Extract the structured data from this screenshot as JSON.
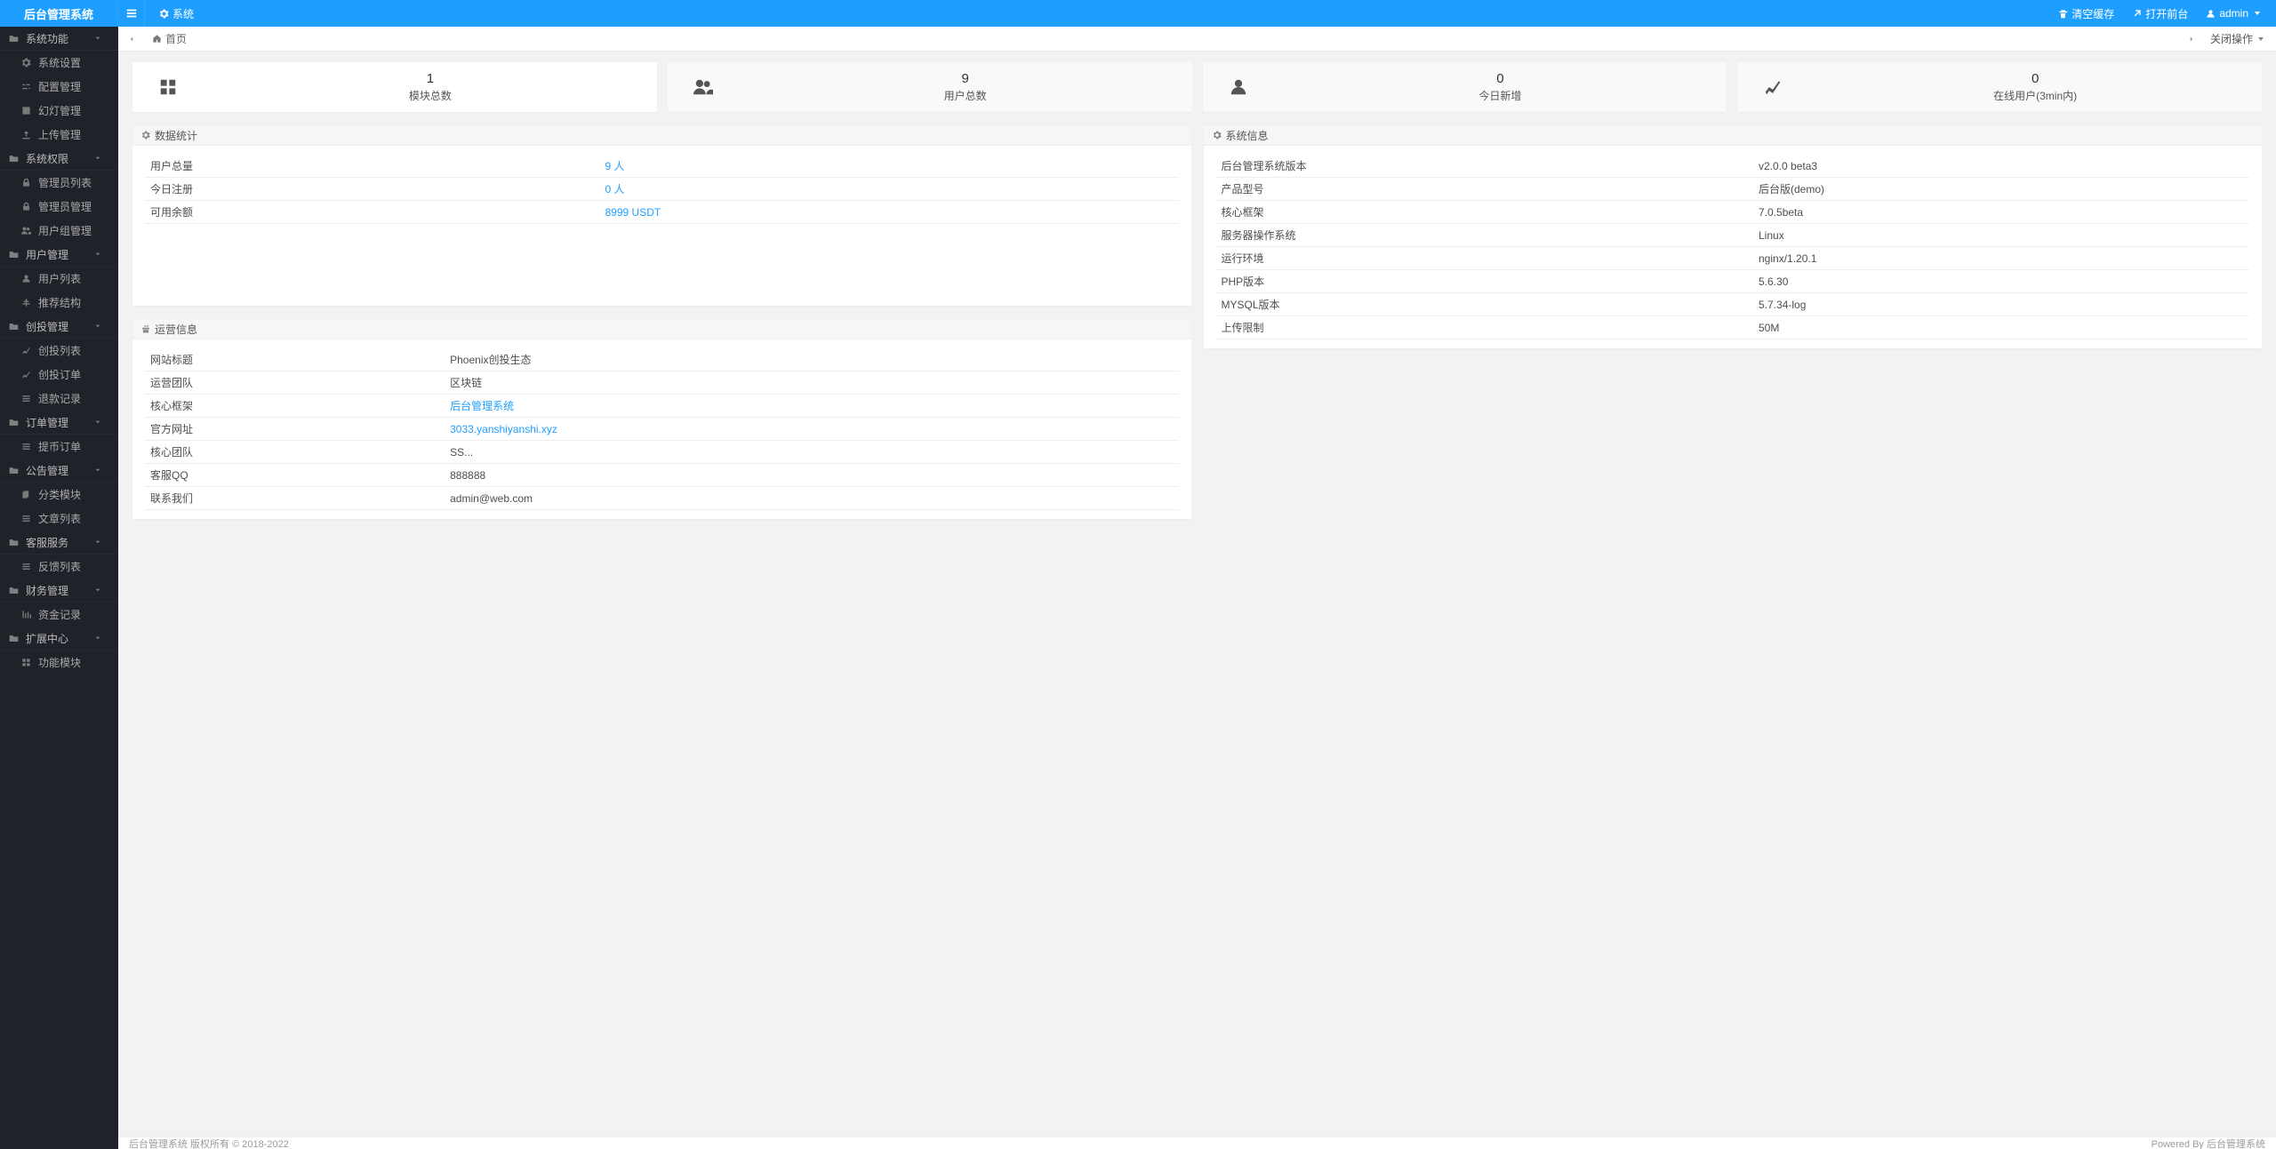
{
  "header": {
    "logo": "后台管理系统",
    "topnav_system": "系统",
    "clear_cache": "清空缓存",
    "open_front": "打开前台",
    "user": "admin"
  },
  "sidebar": [
    {
      "type": "group",
      "name": "sys-func",
      "label": "系统功能"
    },
    {
      "type": "item",
      "name": "sys-settings",
      "label": "系统设置",
      "icon": "gear"
    },
    {
      "type": "item",
      "name": "config-mgmt",
      "label": "配置管理",
      "icon": "sliders"
    },
    {
      "type": "item",
      "name": "slideshow-mgmt",
      "label": "幻灯管理",
      "icon": "image"
    },
    {
      "type": "item",
      "name": "upload-mgmt",
      "label": "上传管理",
      "icon": "upload"
    },
    {
      "type": "group",
      "name": "sys-perm",
      "label": "系统权限"
    },
    {
      "type": "item",
      "name": "admin-list",
      "label": "管理员列表",
      "icon": "lock"
    },
    {
      "type": "item",
      "name": "admin-mgmt",
      "label": "管理员管理",
      "icon": "lock"
    },
    {
      "type": "item",
      "name": "usergroup-mgmt",
      "label": "用户组管理",
      "icon": "users"
    },
    {
      "type": "group",
      "name": "user-mgmt",
      "label": "用户管理"
    },
    {
      "type": "item",
      "name": "user-list",
      "label": "用户列表",
      "icon": "user"
    },
    {
      "type": "item",
      "name": "referral-struct",
      "label": "推荐结构",
      "icon": "tree"
    },
    {
      "type": "group",
      "name": "invest-mgmt",
      "label": "创投管理"
    },
    {
      "type": "item",
      "name": "invest-list",
      "label": "创投列表",
      "icon": "chart"
    },
    {
      "type": "item",
      "name": "invest-orders",
      "label": "创投订单",
      "icon": "chart"
    },
    {
      "type": "item",
      "name": "refund-record",
      "label": "退款记录",
      "icon": "list"
    },
    {
      "type": "group",
      "name": "order-mgmt",
      "label": "订单管理"
    },
    {
      "type": "item",
      "name": "withdraw-orders",
      "label": "提币订单",
      "icon": "list"
    },
    {
      "type": "group",
      "name": "notice-mgmt",
      "label": "公告管理"
    },
    {
      "type": "item",
      "name": "category-module",
      "label": "分类模块",
      "icon": "copy"
    },
    {
      "type": "item",
      "name": "article-list",
      "label": "文章列表",
      "icon": "list"
    },
    {
      "type": "group",
      "name": "service",
      "label": "客服服务"
    },
    {
      "type": "item",
      "name": "feedback-list",
      "label": "反馈列表",
      "icon": "list"
    },
    {
      "type": "group",
      "name": "finance-mgmt",
      "label": "财务管理"
    },
    {
      "type": "item",
      "name": "fund-record",
      "label": "资金记录",
      "icon": "bars"
    },
    {
      "type": "group",
      "name": "extend",
      "label": "扩展中心"
    },
    {
      "type": "item",
      "name": "func-module",
      "label": "功能模块",
      "icon": "grid"
    }
  ],
  "tabs": {
    "home_label": "首页",
    "close_ops": "关闭操作"
  },
  "stats": [
    {
      "value": "1",
      "label": "模块总数",
      "icon": "grid",
      "active": true
    },
    {
      "value": "9",
      "label": "用户总数",
      "icon": "users",
      "active": false
    },
    {
      "value": "0",
      "label": "今日新增",
      "icon": "user",
      "active": false
    },
    {
      "value": "0",
      "label": "在线用户(3min内)",
      "icon": "chart",
      "active": false
    }
  ],
  "panels": {
    "data_stats": {
      "title": "数据统计",
      "rows": [
        {
          "k": "用户总量",
          "v": "9 人",
          "link": true
        },
        {
          "k": "今日注册",
          "v": "0 人",
          "link": true
        },
        {
          "k": "可用余额",
          "v": "8999 USDT",
          "link": true
        }
      ]
    },
    "sys_info": {
      "title": "系统信息",
      "rows": [
        {
          "k": "后台管理系统版本",
          "v": "v2.0.0 beta3"
        },
        {
          "k": "产品型号",
          "v": "后台版(demo)"
        },
        {
          "k": "核心框架",
          "v": "7.0.5beta"
        },
        {
          "k": "服务器操作系统",
          "v": "Linux"
        },
        {
          "k": "运行环境",
          "v": "nginx/1.20.1"
        },
        {
          "k": "PHP版本",
          "v": "5.6.30"
        },
        {
          "k": "MYSQL版本",
          "v": "5.7.34-log"
        },
        {
          "k": "上传限制",
          "v": "50M"
        }
      ]
    },
    "ops_info": {
      "title": "运营信息",
      "rows": [
        {
          "k": "网站标题",
          "v": "Phoenix创投生态"
        },
        {
          "k": "运营团队",
          "v": "区块链"
        },
        {
          "k": "核心框架",
          "v": "后台管理系统",
          "link": true
        },
        {
          "k": "官方网址",
          "v": "3033.yanshiyanshi.xyz",
          "link": true
        },
        {
          "k": "核心团队",
          "v": "SS..."
        },
        {
          "k": "客服QQ",
          "v": "888888"
        },
        {
          "k": "联系我们",
          "v": "admin@web.com"
        }
      ]
    }
  },
  "footer": {
    "left": "后台管理系统 版权所有 © 2018-2022",
    "right": "Powered By 后台管理系统"
  }
}
